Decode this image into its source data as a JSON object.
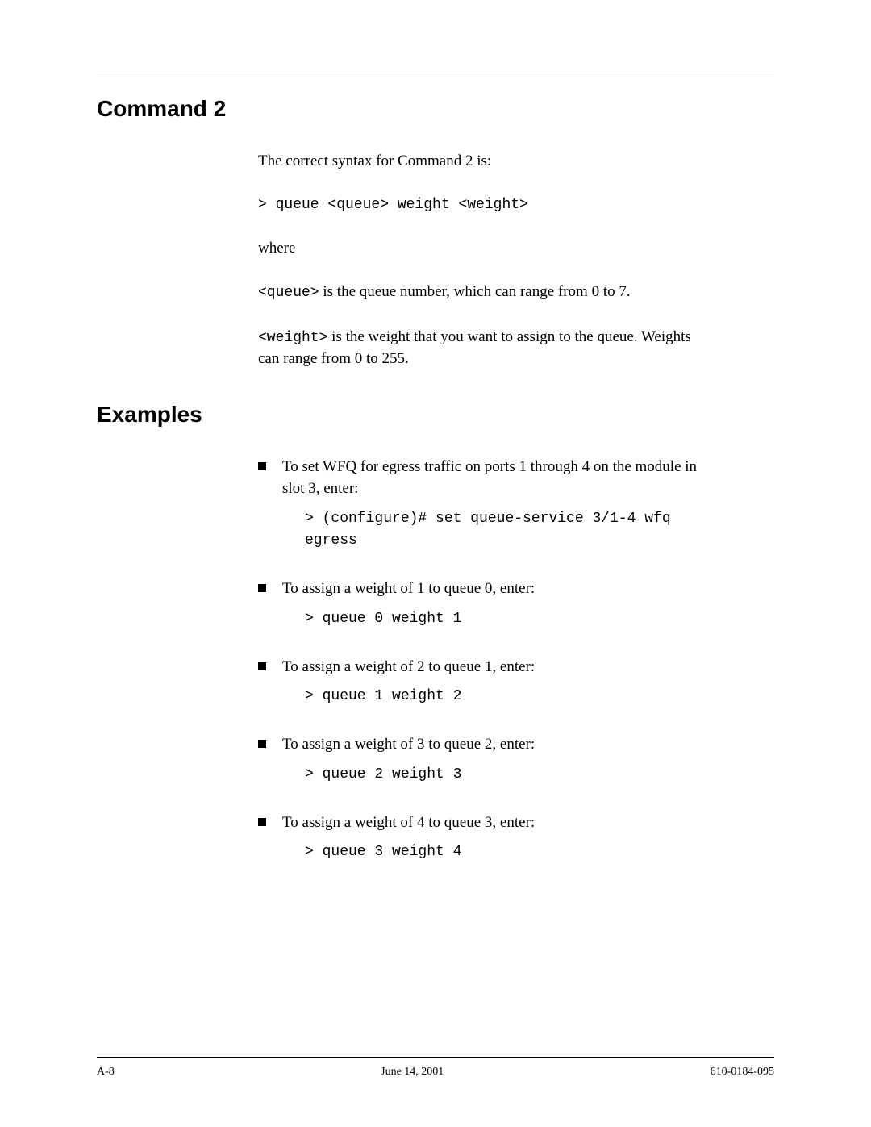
{
  "sections": {
    "command2": {
      "heading": "Command 2",
      "intro": "The correct syntax for Command 2 is:",
      "syntax": "> queue <queue> weight <weight>",
      "where_label": "where",
      "queue_param_code": "<queue>",
      "queue_param_text": " is the queue number, which can range from 0 to 7.",
      "weight_param_code": "<weight>",
      "weight_param_text": " is the weight that you want to assign to the queue. Weights can range from 0 to 255."
    },
    "examples": {
      "heading": "Examples",
      "items": [
        {
          "text": "To set WFQ for egress traffic on ports 1 through 4 on the module in slot 3, enter:",
          "code": "> (configure)# set queue-service 3/1-4 wfq egress"
        },
        {
          "text": "To assign a weight of 1 to queue 0, enter:",
          "code": "> queue 0 weight 1"
        },
        {
          "text": "To assign a weight of 2 to queue 1, enter:",
          "code": "> queue 1 weight 2"
        },
        {
          "text": "To assign a weight of 3 to queue 2, enter:",
          "code": "> queue 2 weight 3"
        },
        {
          "text": "To assign a weight of 4 to queue 3, enter:",
          "code": "> queue 3 weight 4"
        }
      ]
    }
  },
  "footer": {
    "page_label": "A-8",
    "date": "June 14, 2001",
    "doc_id": "610-0184-095"
  }
}
